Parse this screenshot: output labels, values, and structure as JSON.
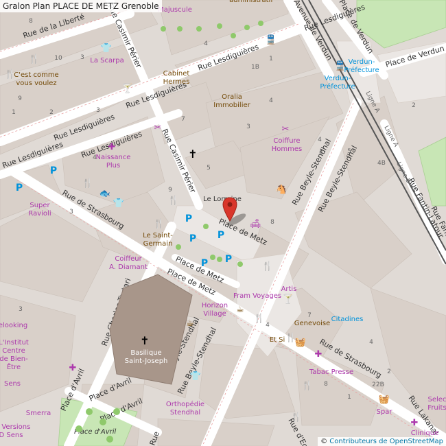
{
  "title": "Gralon Plan PLACE DE METZ Grenoble",
  "attribution": {
    "symbol": "©",
    "link": "Contributeurs de OpenStreetMap"
  },
  "colors": {
    "building": "#d9d0c9",
    "road": "#ffffff",
    "square": "#eae6e3",
    "park": "#c8e6b5",
    "poi_magenta": "#ac39ac",
    "poi_brown": "#734a08",
    "parking_blue": "#0092da",
    "pin": "#d9362b",
    "railway": "#444444"
  },
  "street_labels": [
    {
      "id": "rue-de-la-liberte",
      "text": "Rue de la Liberté"
    },
    {
      "id": "rue-casimir-perier-top",
      "text": "Rue Casimir Périer"
    },
    {
      "id": "rue-casimir-perier-mid",
      "text": "Rue Casimir Périer"
    },
    {
      "id": "rue-lesdiguieres-1",
      "text": "Rue Lesdiguières"
    },
    {
      "id": "rue-lesdiguieres-2",
      "text": "Rue Lesdiguières"
    },
    {
      "id": "rue-lesdiguieres-3",
      "text": "Rue Lesdiguières"
    },
    {
      "id": "rue-lesdiguieres-4",
      "text": "Rue Lesdiguières"
    },
    {
      "id": "rue-lesdiguieres-5",
      "text": "Rue Lesdiguières"
    },
    {
      "id": "rue-lesdiguieres-6",
      "text": "Rue Lesdiguières"
    },
    {
      "id": "avenue-de-verdun",
      "text": "Avenue de Verdun"
    },
    {
      "id": "place-de-verdun-top",
      "text": "Place de Verdun"
    },
    {
      "id": "place-de-verdun",
      "text": "Place de Verdun"
    },
    {
      "id": "rue-de-strasbourg-left",
      "text": "Rue de Strasbourg"
    },
    {
      "id": "rue-de-strasbourg-right",
      "text": "Rue de Strasbourg"
    },
    {
      "id": "place-de-metz-1",
      "text": "Place de Metz"
    },
    {
      "id": "place-de-metz-2",
      "text": "Place de Metz"
    },
    {
      "id": "place-de-metz-3",
      "text": "Place de Metz"
    },
    {
      "id": "rue-beyle-stendhal-1",
      "text": "Rue Beyle-Stendhal"
    },
    {
      "id": "rue-beyle-stendhal-2",
      "text": "Rue Beyle-Stendhal"
    },
    {
      "id": "rue-beyle-stendhal-3",
      "text": "Rue Beyle-Stendhal"
    },
    {
      "id": "rue-beyle-stendhal-4",
      "text": "Rue Beyle-Stendhal"
    },
    {
      "id": "rue-charles-tartari",
      "text": "Rue Charles Tartari"
    },
    {
      "id": "place-davril-1",
      "text": "Place d'Avril"
    },
    {
      "id": "place-davril-2",
      "text": "Place d'Avril"
    },
    {
      "id": "place-davril-3",
      "text": "Place d'Avril"
    },
    {
      "id": "place-davril-park",
      "text": "Place d'Avril"
    },
    {
      "id": "rue-lakanal",
      "text": "Rue Lakanal"
    },
    {
      "id": "rue-fantin-latour",
      "text": "Rue Fantin-Latour"
    },
    {
      "id": "rue-fantin-right",
      "text": "Rue Fantin"
    },
    {
      "id": "ligne-a-1",
      "text": "Ligne A"
    },
    {
      "id": "ligne-a-2",
      "text": "Ligne A"
    },
    {
      "id": "ligne-b",
      "text": "Ligne B"
    },
    {
      "id": "rue-decciaria",
      "text": "Rue d'Eccaria"
    },
    {
      "id": "rue-bottom-left",
      "text": "Rue"
    }
  ],
  "poi_labels": [
    {
      "id": "majuscule",
      "text": "Majuscule"
    },
    {
      "id": "administratif",
      "text": "administratif"
    },
    {
      "id": "la-scarpa",
      "text": "La Scarpa"
    },
    {
      "id": "cest-comme-vous-voulez-1",
      "text": "C'est comme"
    },
    {
      "id": "cest-comme-vous-voulez-2",
      "text": "vous voulez"
    },
    {
      "id": "cabinet-hermes-1",
      "text": "Cabinet"
    },
    {
      "id": "cabinet-hermes-2",
      "text": "Hermes"
    },
    {
      "id": "oralia-1",
      "text": "Oralia"
    },
    {
      "id": "oralia-2",
      "text": "Immobilier"
    },
    {
      "id": "verdun-prefecture-1a",
      "text": "Verdun-"
    },
    {
      "id": "verdun-prefecture-1b",
      "text": "Préfecture"
    },
    {
      "id": "verdun-prefecture-2a",
      "text": "Verdun-"
    },
    {
      "id": "verdun-prefecture-2b",
      "text": "Préfecture"
    },
    {
      "id": "coiffure-hommes-1",
      "text": "Coiffure"
    },
    {
      "id": "coiffure-hommes-2",
      "text": "Hommes"
    },
    {
      "id": "naissance-plus-1",
      "text": "Naissance"
    },
    {
      "id": "naissance-plus-2",
      "text": "Plus"
    },
    {
      "id": "le-lorraine",
      "text": "Le Lorraine"
    },
    {
      "id": "super-ravioli-1",
      "text": "Super"
    },
    {
      "id": "super-ravioli-2",
      "text": "Ravioli"
    },
    {
      "id": "le-saint-germain-1",
      "text": "Le Saint-"
    },
    {
      "id": "le-saint-germain-2",
      "text": "Germain"
    },
    {
      "id": "coiffeur-1",
      "text": "Coiffeur"
    },
    {
      "id": "coiffeur-2",
      "text": "A. Diamant"
    },
    {
      "id": "fram-voyages",
      "text": "Fram Voyages"
    },
    {
      "id": "artis",
      "text": "Artis"
    },
    {
      "id": "horizon-village-1",
      "text": "Horizon"
    },
    {
      "id": "horizon-village-2",
      "text": "Village"
    },
    {
      "id": "genevoise",
      "text": "Genevoise"
    },
    {
      "id": "citadines",
      "text": "Citadines"
    },
    {
      "id": "basilique-1",
      "text": "Basilique"
    },
    {
      "id": "basilique-2",
      "text": "Saint-Joseph"
    },
    {
      "id": "tabac-presse",
      "text": "Tabac Presse"
    },
    {
      "id": "et-si",
      "text": "Et Si"
    },
    {
      "id": "orthopedie-1",
      "text": "Orthopédie"
    },
    {
      "id": "orthopedie-2",
      "text": "Stendhal"
    },
    {
      "id": "spar",
      "text": "Spar"
    },
    {
      "id": "clinique",
      "text": "Clinique"
    },
    {
      "id": "smerra",
      "text": "Smerra"
    },
    {
      "id": "institut-1",
      "text": "L'Institut"
    },
    {
      "id": "institut-2",
      "text": "Centre"
    },
    {
      "id": "institut-3",
      "text": "de Bien-"
    },
    {
      "id": "institut-4",
      "text": "Être"
    },
    {
      "id": "velooking",
      "text": "Velooking"
    },
    {
      "id": "sens",
      "text": "Sens"
    },
    {
      "id": "ns-versions",
      "text": "ns Versions"
    },
    {
      "id": "d-sens",
      "text": "D Sens"
    },
    {
      "id": "select-1",
      "text": "Selec"
    },
    {
      "id": "select-2",
      "text": "Fruits"
    }
  ],
  "house_numbers": [
    "8",
    "4",
    "10",
    "1B",
    "1",
    "4",
    "7",
    "3",
    "5",
    "2",
    "4",
    "6",
    "8",
    "5",
    "4B",
    "22B",
    "2",
    "1",
    "8",
    "4",
    "7",
    "4",
    "9",
    "3",
    "3",
    "9",
    "2",
    "1",
    "4",
    "3",
    "3"
  ],
  "marker": {
    "place": "Place de Metz"
  }
}
